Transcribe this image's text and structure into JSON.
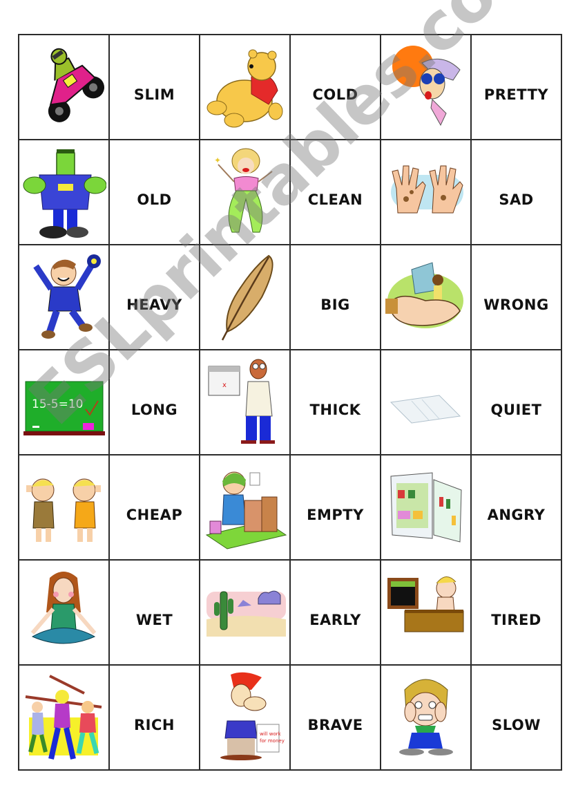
{
  "document": {
    "type": "flashcard-grid",
    "rows": [
      [
        {
          "kind": "picture",
          "icon": "motorbike-rider-icon",
          "desc": "motorbike"
        },
        {
          "kind": "word",
          "text": "SLIM"
        },
        {
          "kind": "picture",
          "icon": "fat-bear-icon",
          "desc": "fat bear"
        },
        {
          "kind": "word",
          "text": "COLD"
        },
        {
          "kind": "picture",
          "icon": "hot-woman-sun-icon",
          "desc": "hot"
        },
        {
          "kind": "word",
          "text": "PRETTY"
        }
      ],
      [
        {
          "kind": "picture",
          "icon": "monster-icon",
          "desc": "ugly monster"
        },
        {
          "kind": "word",
          "text": "OLD"
        },
        {
          "kind": "picture",
          "icon": "young-woman-icon",
          "desc": "young woman"
        },
        {
          "kind": "word",
          "text": "CLEAN"
        },
        {
          "kind": "picture",
          "icon": "dirty-hands-icon",
          "desc": "dirty hands"
        },
        {
          "kind": "word",
          "text": "SAD"
        }
      ],
      [
        {
          "kind": "picture",
          "icon": "happy-boy-icon",
          "desc": "happy boy"
        },
        {
          "kind": "word",
          "text": "HEAVY"
        },
        {
          "kind": "picture",
          "icon": "feather-icon",
          "desc": "feather"
        },
        {
          "kind": "word",
          "text": "BIG"
        },
        {
          "kind": "picture",
          "icon": "small-man-in-hands-icon",
          "desc": "small"
        },
        {
          "kind": "word",
          "text": "WRONG"
        }
      ],
      [
        {
          "kind": "picture",
          "icon": "chalkboard-icon",
          "desc": "right answer",
          "board_text": "15-5=10"
        },
        {
          "kind": "word",
          "text": "LONG"
        },
        {
          "kind": "picture",
          "icon": "calendar-man-icon",
          "desc": "short"
        },
        {
          "kind": "word",
          "text": "THICK"
        },
        {
          "kind": "picture",
          "icon": "thin-paper-icon",
          "desc": "thin"
        },
        {
          "kind": "word",
          "text": "QUIET"
        }
      ],
      [
        {
          "kind": "picture",
          "icon": "noisy-kids-icon",
          "desc": "noisy"
        },
        {
          "kind": "word",
          "text": "CHEAP"
        },
        {
          "kind": "picture",
          "icon": "shopping-receipt-icon",
          "desc": "expensive"
        },
        {
          "kind": "word",
          "text": "EMPTY"
        },
        {
          "kind": "picture",
          "icon": "full-fridge-icon",
          "desc": "full"
        },
        {
          "kind": "word",
          "text": "ANGRY"
        }
      ],
      [
        {
          "kind": "picture",
          "icon": "calm-girl-yoga-icon",
          "desc": "calm"
        },
        {
          "kind": "word",
          "text": "WET"
        },
        {
          "kind": "picture",
          "icon": "desert-cactus-icon",
          "desc": "dry"
        },
        {
          "kind": "word",
          "text": "EARLY"
        },
        {
          "kind": "picture",
          "icon": "night-desk-man-icon",
          "desc": "late"
        },
        {
          "kind": "word",
          "text": "TIRED"
        }
      ],
      [
        {
          "kind": "picture",
          "icon": "exercising-people-icon",
          "desc": "energetic"
        },
        {
          "kind": "word",
          "text": "RICH"
        },
        {
          "kind": "picture",
          "icon": "poor-man-sign-icon",
          "desc": "poor",
          "sign_text": "will work for money"
        },
        {
          "kind": "word",
          "text": "BRAVE"
        },
        {
          "kind": "picture",
          "icon": "scared-boy-icon",
          "desc": "scared"
        },
        {
          "kind": "word",
          "text": "SLOW"
        }
      ]
    ]
  },
  "watermark": "ESLprintables.com"
}
